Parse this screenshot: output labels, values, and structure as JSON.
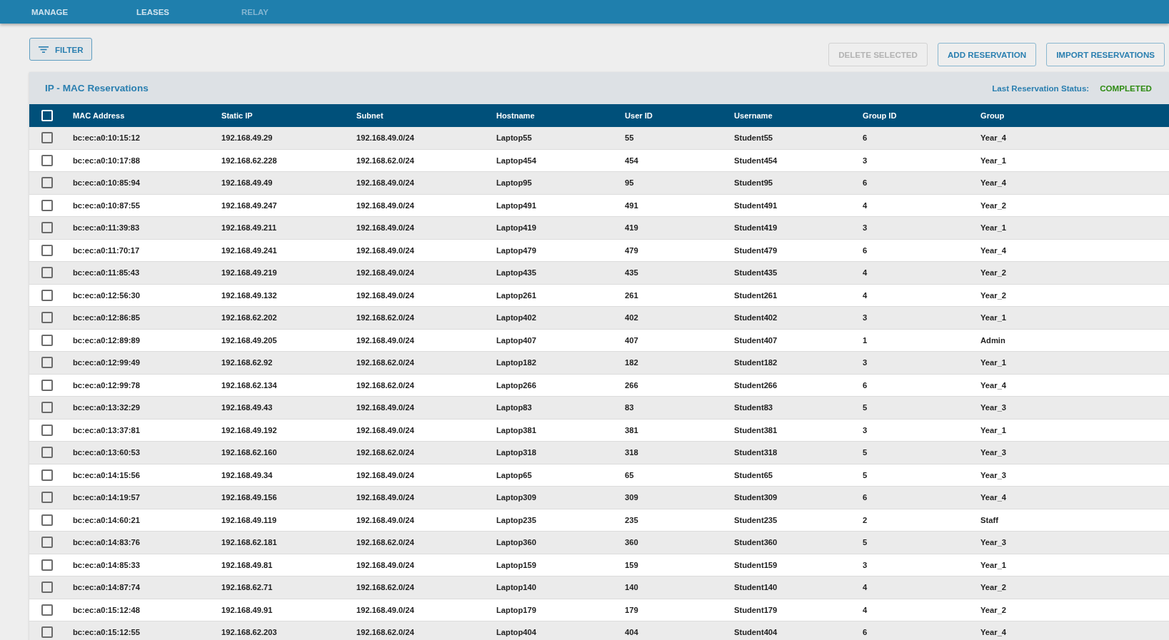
{
  "nav_tabs": [
    {
      "label": "MANAGE",
      "disabled": false
    },
    {
      "label": "LEASES",
      "disabled": false
    },
    {
      "label": "RELAY",
      "disabled": true
    }
  ],
  "toolbar": {
    "filter_button": {
      "label": "FILTER"
    },
    "buttons": [
      {
        "label": "DELETE SELECTED",
        "disabled": true
      },
      {
        "label": "ADD RESERVATION",
        "disabled": false
      },
      {
        "label": "IMPORT RESERVATIONS",
        "disabled": false
      }
    ]
  },
  "panel": {
    "title": "IP - MAC Reservations",
    "status_label": "Last Reservation Status:",
    "status_value": "COMPLETED"
  },
  "table": {
    "select_all_checked": false,
    "columns": [
      "MAC Address",
      "Static IP",
      "Subnet",
      "Hostname",
      "User ID",
      "Username",
      "Group ID",
      "Group"
    ],
    "rows": [
      {
        "checked": false,
        "cells": [
          "bc:ec:a0:10:15:12",
          "192.168.49.29",
          "192.168.49.0/24",
          "Laptop55",
          "55",
          "Student55",
          "6",
          "Year_4"
        ]
      },
      {
        "checked": false,
        "cells": [
          "bc:ec:a0:10:17:88",
          "192.168.62.228",
          "192.168.62.0/24",
          "Laptop454",
          "454",
          "Student454",
          "3",
          "Year_1"
        ]
      },
      {
        "checked": false,
        "cells": [
          "bc:ec:a0:10:85:94",
          "192.168.49.49",
          "192.168.49.0/24",
          "Laptop95",
          "95",
          "Student95",
          "6",
          "Year_4"
        ]
      },
      {
        "checked": false,
        "cells": [
          "bc:ec:a0:10:87:55",
          "192.168.49.247",
          "192.168.49.0/24",
          "Laptop491",
          "491",
          "Student491",
          "4",
          "Year_2"
        ]
      },
      {
        "checked": false,
        "cells": [
          "bc:ec:a0:11:39:83",
          "192.168.49.211",
          "192.168.49.0/24",
          "Laptop419",
          "419",
          "Student419",
          "3",
          "Year_1"
        ]
      },
      {
        "checked": false,
        "cells": [
          "bc:ec:a0:11:70:17",
          "192.168.49.241",
          "192.168.49.0/24",
          "Laptop479",
          "479",
          "Student479",
          "6",
          "Year_4"
        ]
      },
      {
        "checked": false,
        "cells": [
          "bc:ec:a0:11:85:43",
          "192.168.49.219",
          "192.168.49.0/24",
          "Laptop435",
          "435",
          "Student435",
          "4",
          "Year_2"
        ]
      },
      {
        "checked": false,
        "cells": [
          "bc:ec:a0:12:56:30",
          "192.168.49.132",
          "192.168.49.0/24",
          "Laptop261",
          "261",
          "Student261",
          "4",
          "Year_2"
        ]
      },
      {
        "checked": false,
        "cells": [
          "bc:ec:a0:12:86:85",
          "192.168.62.202",
          "192.168.62.0/24",
          "Laptop402",
          "402",
          "Student402",
          "3",
          "Year_1"
        ]
      },
      {
        "checked": false,
        "cells": [
          "bc:ec:a0:12:89:89",
          "192.168.49.205",
          "192.168.49.0/24",
          "Laptop407",
          "407",
          "Student407",
          "1",
          "Admin"
        ]
      },
      {
        "checked": false,
        "cells": [
          "bc:ec:a0:12:99:49",
          "192.168.62.92",
          "192.168.62.0/24",
          "Laptop182",
          "182",
          "Student182",
          "3",
          "Year_1"
        ]
      },
      {
        "checked": false,
        "cells": [
          "bc:ec:a0:12:99:78",
          "192.168.62.134",
          "192.168.62.0/24",
          "Laptop266",
          "266",
          "Student266",
          "6",
          "Year_4"
        ]
      },
      {
        "checked": false,
        "cells": [
          "bc:ec:a0:13:32:29",
          "192.168.49.43",
          "192.168.49.0/24",
          "Laptop83",
          "83",
          "Student83",
          "5",
          "Year_3"
        ]
      },
      {
        "checked": false,
        "cells": [
          "bc:ec:a0:13:37:81",
          "192.168.49.192",
          "192.168.49.0/24",
          "Laptop381",
          "381",
          "Student381",
          "3",
          "Year_1"
        ]
      },
      {
        "checked": false,
        "cells": [
          "bc:ec:a0:13:60:53",
          "192.168.62.160",
          "192.168.62.0/24",
          "Laptop318",
          "318",
          "Student318",
          "5",
          "Year_3"
        ]
      },
      {
        "checked": false,
        "cells": [
          "bc:ec:a0:14:15:56",
          "192.168.49.34",
          "192.168.49.0/24",
          "Laptop65",
          "65",
          "Student65",
          "5",
          "Year_3"
        ]
      },
      {
        "checked": false,
        "cells": [
          "bc:ec:a0:14:19:57",
          "192.168.49.156",
          "192.168.49.0/24",
          "Laptop309",
          "309",
          "Student309",
          "6",
          "Year_4"
        ]
      },
      {
        "checked": false,
        "cells": [
          "bc:ec:a0:14:60:21",
          "192.168.49.119",
          "192.168.49.0/24",
          "Laptop235",
          "235",
          "Student235",
          "2",
          "Staff"
        ]
      },
      {
        "checked": false,
        "cells": [
          "bc:ec:a0:14:83:76",
          "192.168.62.181",
          "192.168.62.0/24",
          "Laptop360",
          "360",
          "Student360",
          "5",
          "Year_3"
        ]
      },
      {
        "checked": false,
        "cells": [
          "bc:ec:a0:14:85:33",
          "192.168.49.81",
          "192.168.49.0/24",
          "Laptop159",
          "159",
          "Student159",
          "3",
          "Year_1"
        ]
      },
      {
        "checked": false,
        "cells": [
          "bc:ec:a0:14:87:74",
          "192.168.62.71",
          "192.168.62.0/24",
          "Laptop140",
          "140",
          "Student140",
          "4",
          "Year_2"
        ]
      },
      {
        "checked": false,
        "cells": [
          "bc:ec:a0:15:12:48",
          "192.168.49.91",
          "192.168.49.0/24",
          "Laptop179",
          "179",
          "Student179",
          "4",
          "Year_2"
        ]
      },
      {
        "checked": false,
        "cells": [
          "bc:ec:a0:15:12:55",
          "192.168.62.203",
          "192.168.62.0/24",
          "Laptop404",
          "404",
          "Student404",
          "6",
          "Year_4"
        ]
      }
    ]
  }
}
